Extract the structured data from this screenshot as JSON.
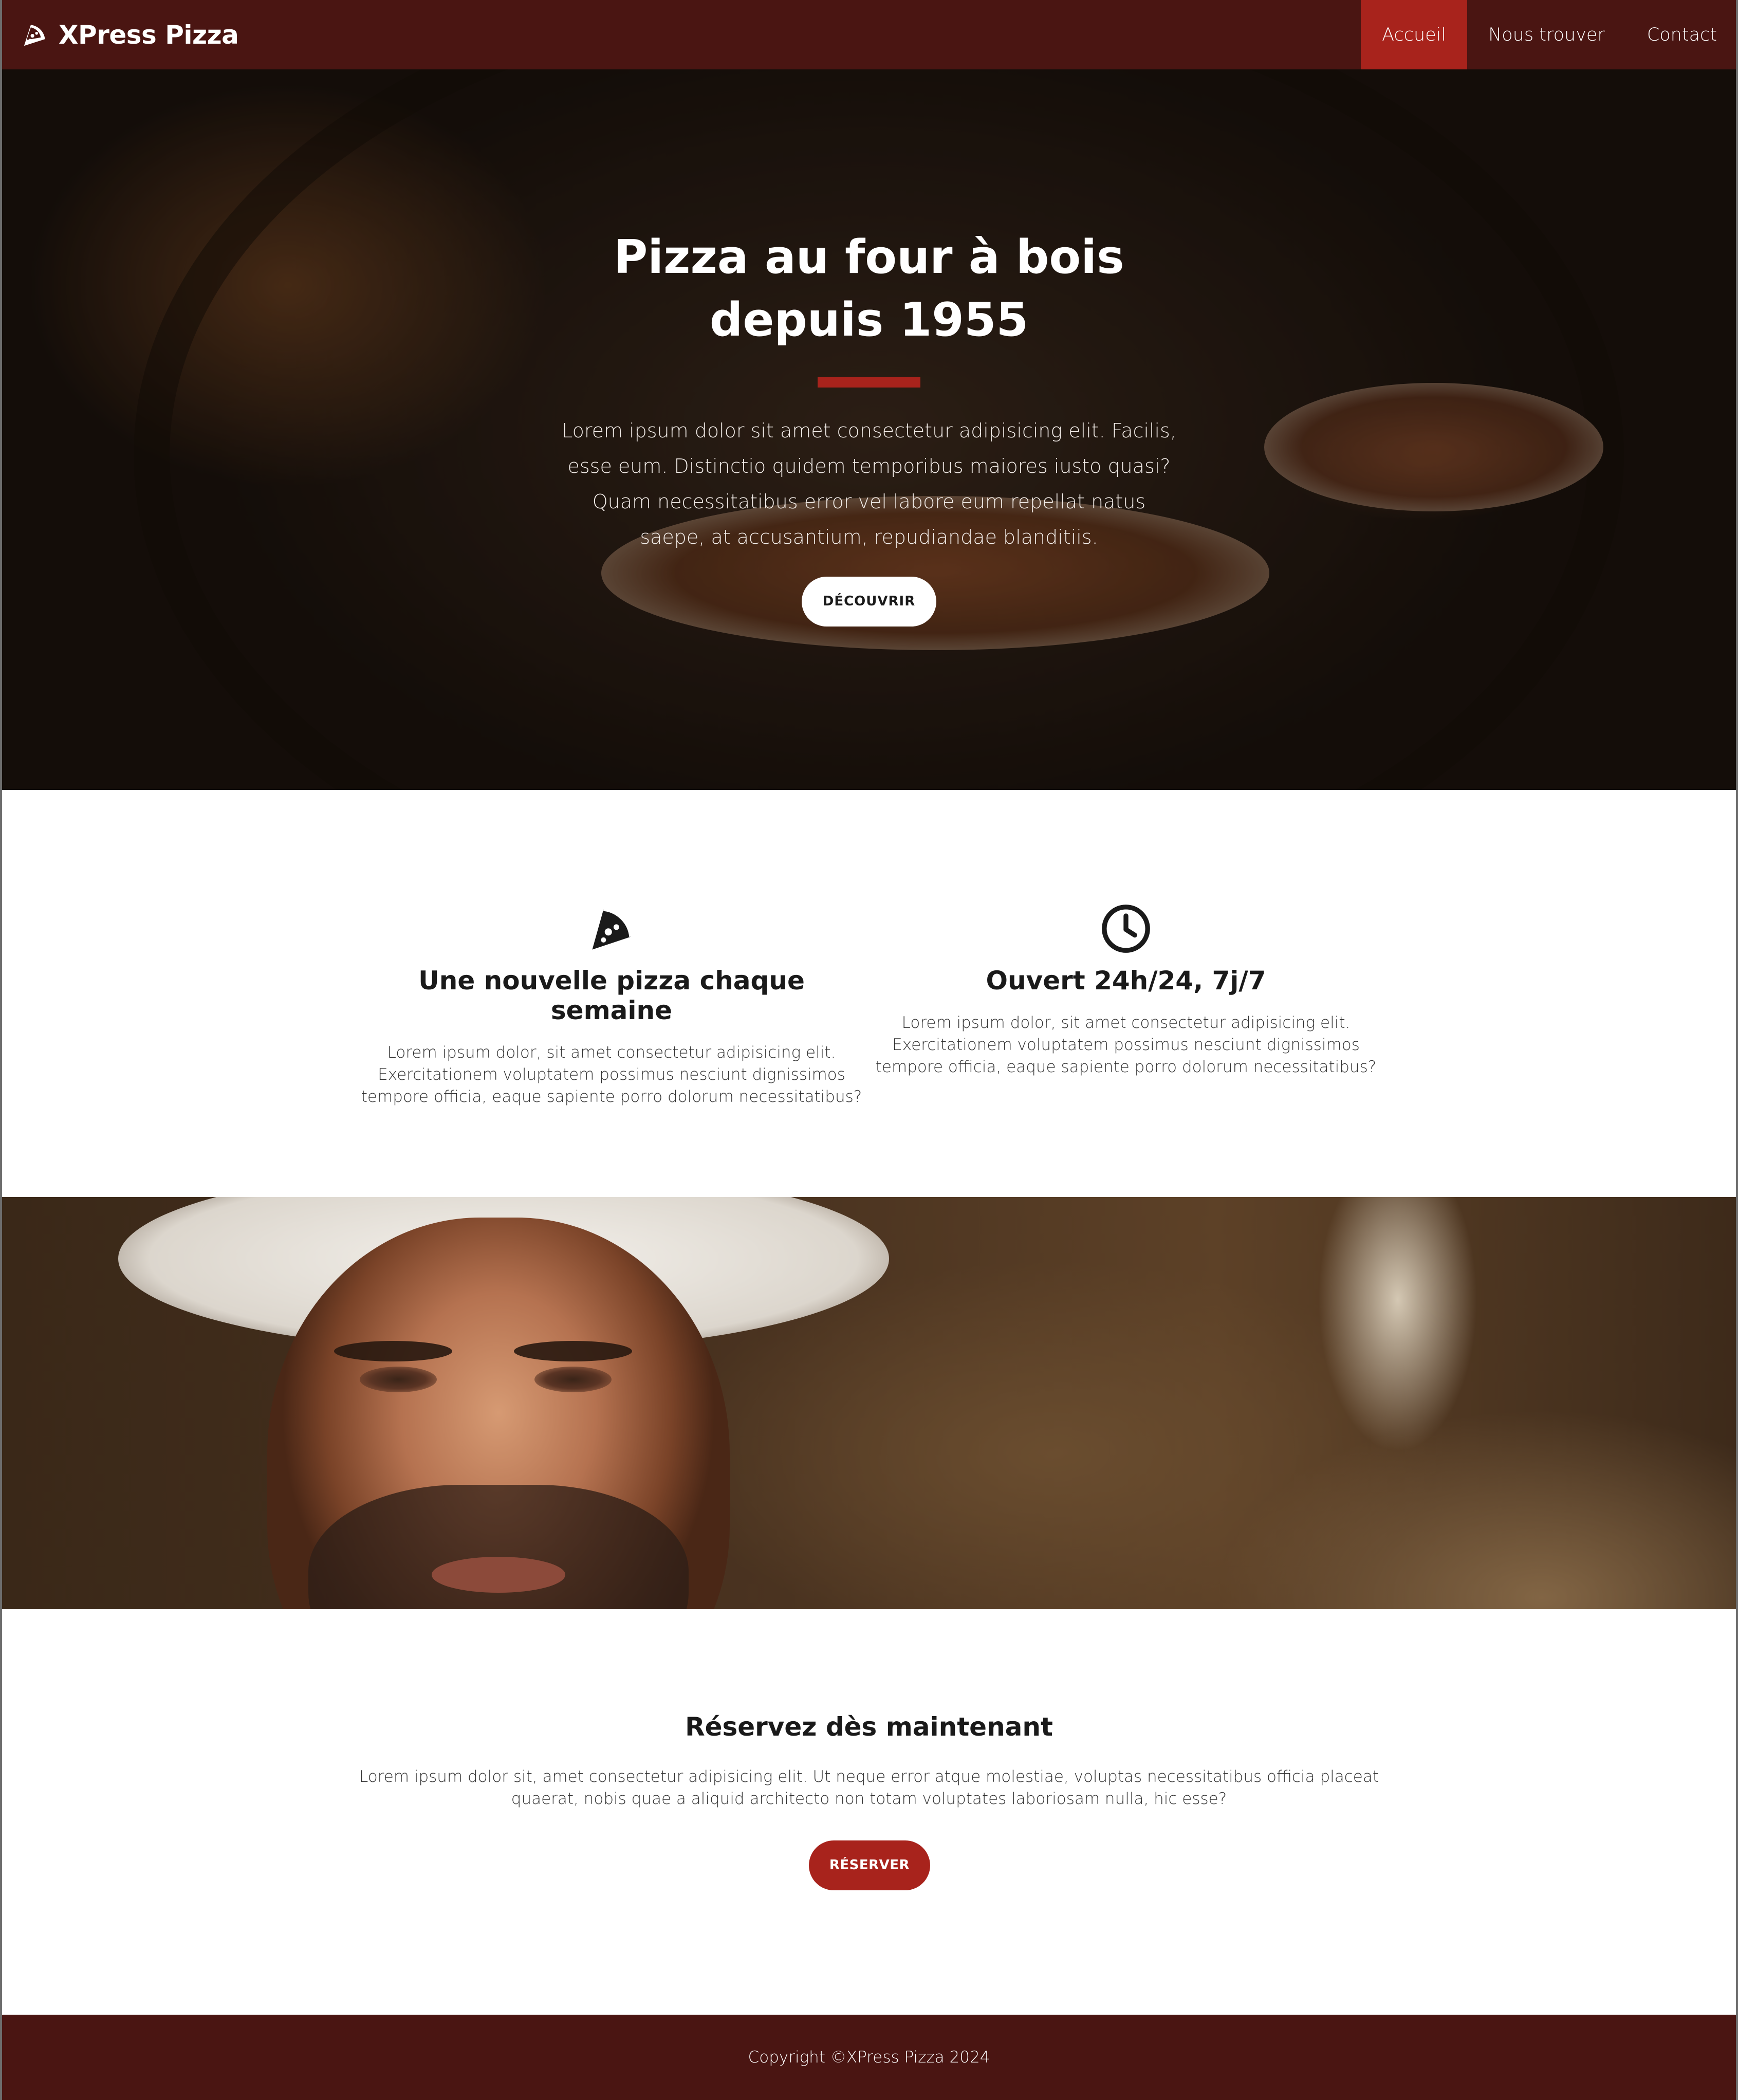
{
  "brand": {
    "name": "XPress Pizza",
    "icon": "pizza-slice-icon"
  },
  "nav": {
    "items": [
      {
        "label": "Accueil",
        "active": true
      },
      {
        "label": "Nous trouver",
        "active": false
      },
      {
        "label": "Contact",
        "active": false
      }
    ]
  },
  "hero": {
    "title": "Pizza au four à bois depuis 1955",
    "text": "Lorem ipsum dolor sit amet consectetur adipisicing elit. Facilis, esse eum. Distinctio quidem temporibus maiores iusto quasi? Quam necessitatibus error vel labore eum repellat natus saepe, at accusantium, repudiandae blanditiis.",
    "button_label": "DÉCOUVRIR"
  },
  "features": [
    {
      "icon": "pizza-slice-icon",
      "title": "Une nouvelle pizza chaque semaine",
      "text": "Lorem ipsum dolor, sit amet consectetur adipisicing elit. Exercitationem voluptatem possimus nesciunt dignissimos tempore officia, eaque sapiente porro dolorum necessitatibus?"
    },
    {
      "icon": "clock-icon",
      "title": "Ouvert 24h/24, 7j/7",
      "text": "Lorem ipsum dolor, sit amet consectetur adipisicing elit. Exercitationem voluptatem possimus nesciunt dignissimos tempore officia, eaque sapiente porro dolorum necessitatibus?"
    }
  ],
  "reserve": {
    "title": "Réservez dès maintenant",
    "text": "Lorem ipsum dolor sit, amet consectetur adipisicing elit. Ut neque error atque molestiae, voluptas necessitatibus officia placeat quaerat, nobis quae a aliquid architecto non totam voluptates laboriosam nulla, hic esse?",
    "button_label": "RÉSERVER"
  },
  "footer": {
    "text": "Copyright ©XPress Pizza 2024"
  },
  "colors": {
    "brand_dark": "#4a1512",
    "accent": "#a8231c",
    "white": "#ffffff"
  }
}
